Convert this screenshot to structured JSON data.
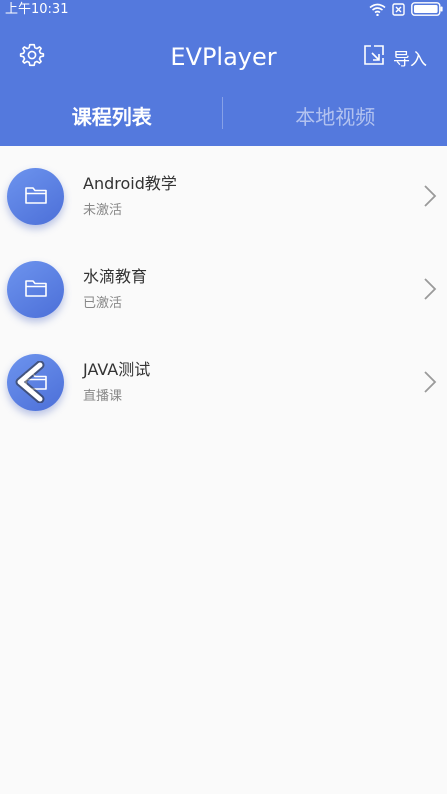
{
  "status_bar": {
    "time": "上午10:31",
    "icons": [
      "wifi-icon",
      "sim-no-signal-icon",
      "battery-icon"
    ]
  },
  "toolbar": {
    "title": "EVPlayer",
    "settings_icon": "gear-icon",
    "import_label": "导入",
    "import_icon": "import-arrow-icon"
  },
  "tabs": [
    {
      "label": "课程列表",
      "active": true
    },
    {
      "label": "本地视频",
      "active": false
    }
  ],
  "courses": [
    {
      "title": "Android教学",
      "status": "未激活",
      "icon": "folder-icon"
    },
    {
      "title": "水滴教育",
      "status": "已激活",
      "icon": "folder-icon"
    },
    {
      "title": "JAVA测试",
      "status": "直播课",
      "icon": "folder-icon"
    }
  ],
  "overlay": {
    "icon": "back-arrow-icon"
  },
  "colors": {
    "primary": "#5479dd",
    "background": "#fafafa",
    "title_text": "#333333",
    "secondary_text": "#888888"
  }
}
